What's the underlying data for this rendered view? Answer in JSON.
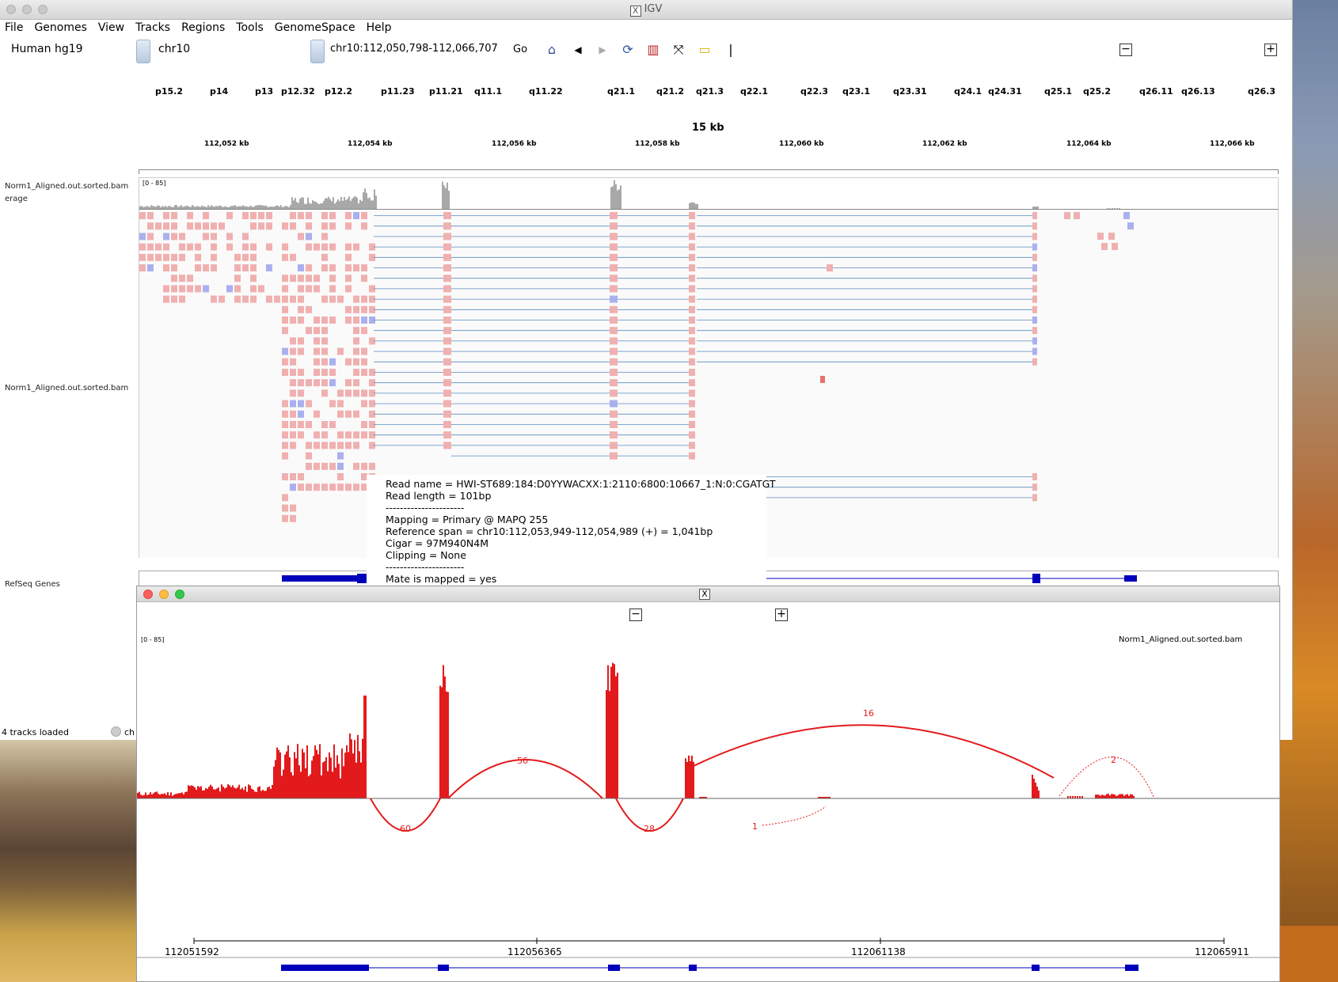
{
  "window": {
    "title": "IGV",
    "menu": [
      "File",
      "Genomes",
      "View",
      "Tracks",
      "Regions",
      "Tools",
      "GenomeSpace",
      "Help"
    ]
  },
  "toolbar": {
    "genome": "Human hg19",
    "chromosome": "chr10",
    "locus": "chr10:112,050,798-112,066,707",
    "go_label": "Go",
    "zoom_out": "−",
    "zoom_in": "+",
    "separator": "|"
  },
  "ideogram": {
    "bands": [
      "p15.2",
      "p14",
      "p13",
      "p12.32",
      "p12.2",
      "p11.23",
      "p11.21",
      "q11.1",
      "q11.22",
      "q21.1",
      "q21.2",
      "q21.3",
      "q22.1",
      "q22.3",
      "q23.1",
      "q23.31",
      "q24.1",
      "q24.31",
      "q25.1",
      "q25.2",
      "q26.11",
      "q26.13",
      "q26.3"
    ]
  },
  "ruler": {
    "span": "15 kb",
    "ticks": [
      "112,052 kb",
      "112,054 kb",
      "112,056 kb",
      "112,058 kb",
      "112,060 kb",
      "112,062 kb",
      "112,064 kb",
      "112,066 kb"
    ]
  },
  "tracks": {
    "coverage_name": "Norm1_Aligned.out.sorted.bam",
    "coverage_name_cont": "erage",
    "coverage_range": "[0 - 85]",
    "alignment_name": "Norm1_Aligned.out.sorted.bam",
    "refseq_name": "RefSeq Genes"
  },
  "status": {
    "loaded": "4 tracks loaded",
    "partial": "ch"
  },
  "popup": {
    "lines": [
      "Read name = HWI-ST689:184:D0YYWACXX:1:2110:6800:10667_1:N:0:CGATGT",
      "Read length = 101bp",
      "----------------------",
      "Mapping = Primary @ MAPQ 255",
      "Reference span = chr10:112,053,949-112,054,989 (+) = 1,041bp",
      "Cigar = 97M940N4M",
      "Clipping = None",
      "----------------------",
      "Mate is mapped = yes"
    ]
  },
  "sashimi": {
    "zoom_out": "−",
    "zoom_in": "+",
    "range": "[0 - 85]",
    "track_name": "Norm1_Aligned.out.sorted.bam",
    "axis_ticks": [
      "112051592",
      "112056365",
      "112061138",
      "112065911"
    ],
    "junctions_above": [
      {
        "label": "56"
      },
      {
        "label": "16"
      },
      {
        "label": "2"
      }
    ],
    "junctions_below": [
      {
        "label": "60"
      },
      {
        "label": "28"
      },
      {
        "label": "1"
      }
    ],
    "color": "#e31a1c"
  },
  "colors": {
    "read": "#f0b0b0",
    "read_reverse": "#aab0ee",
    "coverage": "#a8a8a8",
    "gene": "#0000bb",
    "sashimi": "#e31a1c"
  }
}
